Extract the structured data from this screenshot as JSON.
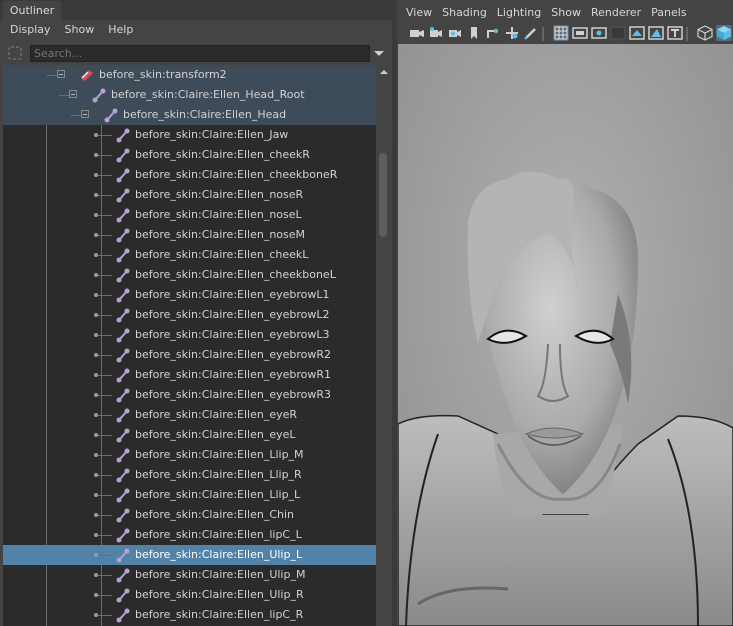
{
  "outliner": {
    "tab_label": "Outliner",
    "menu": [
      "Display",
      "Show",
      "Help"
    ],
    "search_placeholder": "Search...",
    "rows": [
      {
        "label": "before_skin:transform2",
        "icon": "transform-icon",
        "state": "ancestor",
        "kind": "expanded"
      },
      {
        "label": "before_skin:Claire:Ellen_Head_Root",
        "icon": "joint-icon",
        "state": "ancestor",
        "kind": "expanded"
      },
      {
        "label": "before_skin:Claire:Ellen_Head",
        "icon": "joint-icon",
        "state": "ancestor",
        "kind": "expanded"
      },
      {
        "label": "before_skin:Claire:Ellen_Jaw",
        "icon": "joint-icon",
        "state": "normal",
        "kind": "leaf"
      },
      {
        "label": "before_skin:Claire:Ellen_cheekR",
        "icon": "joint-icon",
        "state": "normal",
        "kind": "leaf"
      },
      {
        "label": "before_skin:Claire:Ellen_cheekboneR",
        "icon": "joint-icon",
        "state": "normal",
        "kind": "leaf"
      },
      {
        "label": "before_skin:Claire:Ellen_noseR",
        "icon": "joint-icon",
        "state": "normal",
        "kind": "leaf"
      },
      {
        "label": "before_skin:Claire:Ellen_noseL",
        "icon": "joint-icon",
        "state": "normal",
        "kind": "leaf"
      },
      {
        "label": "before_skin:Claire:Ellen_noseM",
        "icon": "joint-icon",
        "state": "normal",
        "kind": "leaf"
      },
      {
        "label": "before_skin:Claire:Ellen_cheekL",
        "icon": "joint-icon",
        "state": "normal",
        "kind": "leaf"
      },
      {
        "label": "before_skin:Claire:Ellen_cheekboneL",
        "icon": "joint-icon",
        "state": "normal",
        "kind": "leaf"
      },
      {
        "label": "before_skin:Claire:Ellen_eyebrowL1",
        "icon": "joint-icon",
        "state": "normal",
        "kind": "leaf"
      },
      {
        "label": "before_skin:Claire:Ellen_eyebrowL2",
        "icon": "joint-icon",
        "state": "normal",
        "kind": "leaf"
      },
      {
        "label": "before_skin:Claire:Ellen_eyebrowL3",
        "icon": "joint-icon",
        "state": "normal",
        "kind": "leaf"
      },
      {
        "label": "before_skin:Claire:Ellen_eyebrowR2",
        "icon": "joint-icon",
        "state": "normal",
        "kind": "leaf"
      },
      {
        "label": "before_skin:Claire:Ellen_eyebrowR1",
        "icon": "joint-icon",
        "state": "normal",
        "kind": "leaf"
      },
      {
        "label": "before_skin:Claire:Ellen_eyebrowR3",
        "icon": "joint-icon",
        "state": "normal",
        "kind": "leaf"
      },
      {
        "label": "before_skin:Claire:Ellen_eyeR",
        "icon": "joint-icon",
        "state": "normal",
        "kind": "leaf"
      },
      {
        "label": "before_skin:Claire:Ellen_eyeL",
        "icon": "joint-icon",
        "state": "normal",
        "kind": "leaf"
      },
      {
        "label": "before_skin:Claire:Ellen_Llip_M",
        "icon": "joint-icon",
        "state": "normal",
        "kind": "leaf"
      },
      {
        "label": "before_skin:Claire:Ellen_Llip_R",
        "icon": "joint-icon",
        "state": "normal",
        "kind": "leaf"
      },
      {
        "label": "before_skin:Claire:Ellen_Llip_L",
        "icon": "joint-icon",
        "state": "normal",
        "kind": "leaf"
      },
      {
        "label": "before_skin:Claire:Ellen_Chin",
        "icon": "joint-icon",
        "state": "normal",
        "kind": "leaf"
      },
      {
        "label": "before_skin:Claire:Ellen_lipC_L",
        "icon": "joint-icon",
        "state": "normal",
        "kind": "leaf"
      },
      {
        "label": "before_skin:Claire:Ellen_Ulip_L",
        "icon": "joint-icon",
        "state": "selected",
        "kind": "leaf"
      },
      {
        "label": "before_skin:Claire:Ellen_Ulip_M",
        "icon": "joint-icon",
        "state": "normal",
        "kind": "leaf"
      },
      {
        "label": "before_skin:Claire:Ellen_Ulip_R",
        "icon": "joint-icon",
        "state": "normal",
        "kind": "leaf"
      },
      {
        "label": "before_skin:Claire:Ellen_lipC_R",
        "icon": "joint-icon",
        "state": "normal",
        "kind": "leaf"
      }
    ]
  },
  "viewport": {
    "menu": [
      "View",
      "Shading",
      "Lighting",
      "Show",
      "Renderer",
      "Panels"
    ],
    "toolbar_icons": [
      "camera-select-icon",
      "camera-attributes-icon",
      "bookmark-icon",
      "image-plane-icon",
      "move-tool-icon",
      "grease-pencil-icon",
      "grid-icon",
      "film-gate-icon",
      "resolution-gate-icon",
      "gate-mask-icon",
      "field-chart-icon",
      "safe-action-icon",
      "safe-title-icon",
      "wireframe-icon",
      "smooth-shade-icon"
    ],
    "active_icons": [
      "grid-icon",
      "smooth-shade-icon"
    ]
  },
  "colors": {
    "panel_bg": "#444444",
    "tree_bg": "#2b2b2b",
    "ancestor_row": "#3e4c5a",
    "selected_row": "#5282a7",
    "joint_icon": "#b9a1d6",
    "viewport_bg": "#a0a0a0",
    "accent": "#5dbde6"
  }
}
